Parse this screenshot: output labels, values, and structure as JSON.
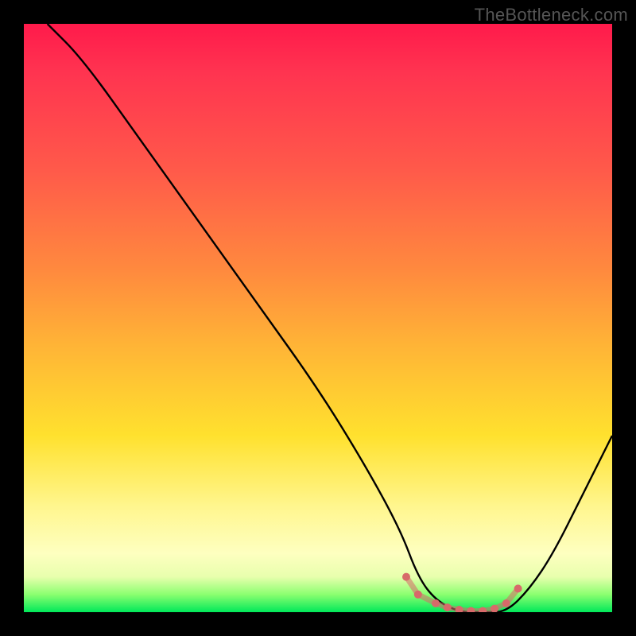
{
  "watermark": "TheBottleneck.com",
  "chart_data": {
    "type": "line",
    "title": "",
    "xlabel": "",
    "ylabel": "",
    "xlim": [
      0,
      100
    ],
    "ylim": [
      0,
      100
    ],
    "grid": false,
    "legend": false,
    "background_gradient_stops": [
      {
        "pct": 0,
        "color": "#ff1a4b"
      },
      {
        "pct": 8,
        "color": "#ff3350"
      },
      {
        "pct": 25,
        "color": "#ff5a4a"
      },
      {
        "pct": 42,
        "color": "#ff8a3e"
      },
      {
        "pct": 55,
        "color": "#ffb536"
      },
      {
        "pct": 70,
        "color": "#ffe12e"
      },
      {
        "pct": 82,
        "color": "#fff68e"
      },
      {
        "pct": 90,
        "color": "#feffc0"
      },
      {
        "pct": 94,
        "color": "#e8ffad"
      },
      {
        "pct": 97,
        "color": "#8bff70"
      },
      {
        "pct": 100,
        "color": "#00e85a"
      }
    ],
    "series": [
      {
        "name": "bottleneck-curve",
        "color": "#000000",
        "note": "V-shaped curve; left arm descends from 100 at x≈4 down to ≈0 at x≈66–82, then rises back to ≈30 at x=100",
        "x": [
          4,
          10,
          20,
          30,
          40,
          50,
          58,
          64,
          67,
          70,
          74,
          78,
          82,
          86,
          90,
          95,
          100
        ],
        "y": [
          100,
          94,
          80,
          66,
          52,
          38,
          25,
          14,
          6,
          2,
          0,
          0,
          0,
          4,
          10,
          20,
          30
        ]
      }
    ],
    "highlight_segment": {
      "name": "trough-dots",
      "color": "#d76a6a",
      "x": [
        65,
        67,
        70,
        72,
        74,
        76,
        78,
        80,
        82,
        84
      ],
      "y": [
        6,
        3,
        1.5,
        0.8,
        0.4,
        0.2,
        0.2,
        0.6,
        1.5,
        4
      ]
    }
  }
}
